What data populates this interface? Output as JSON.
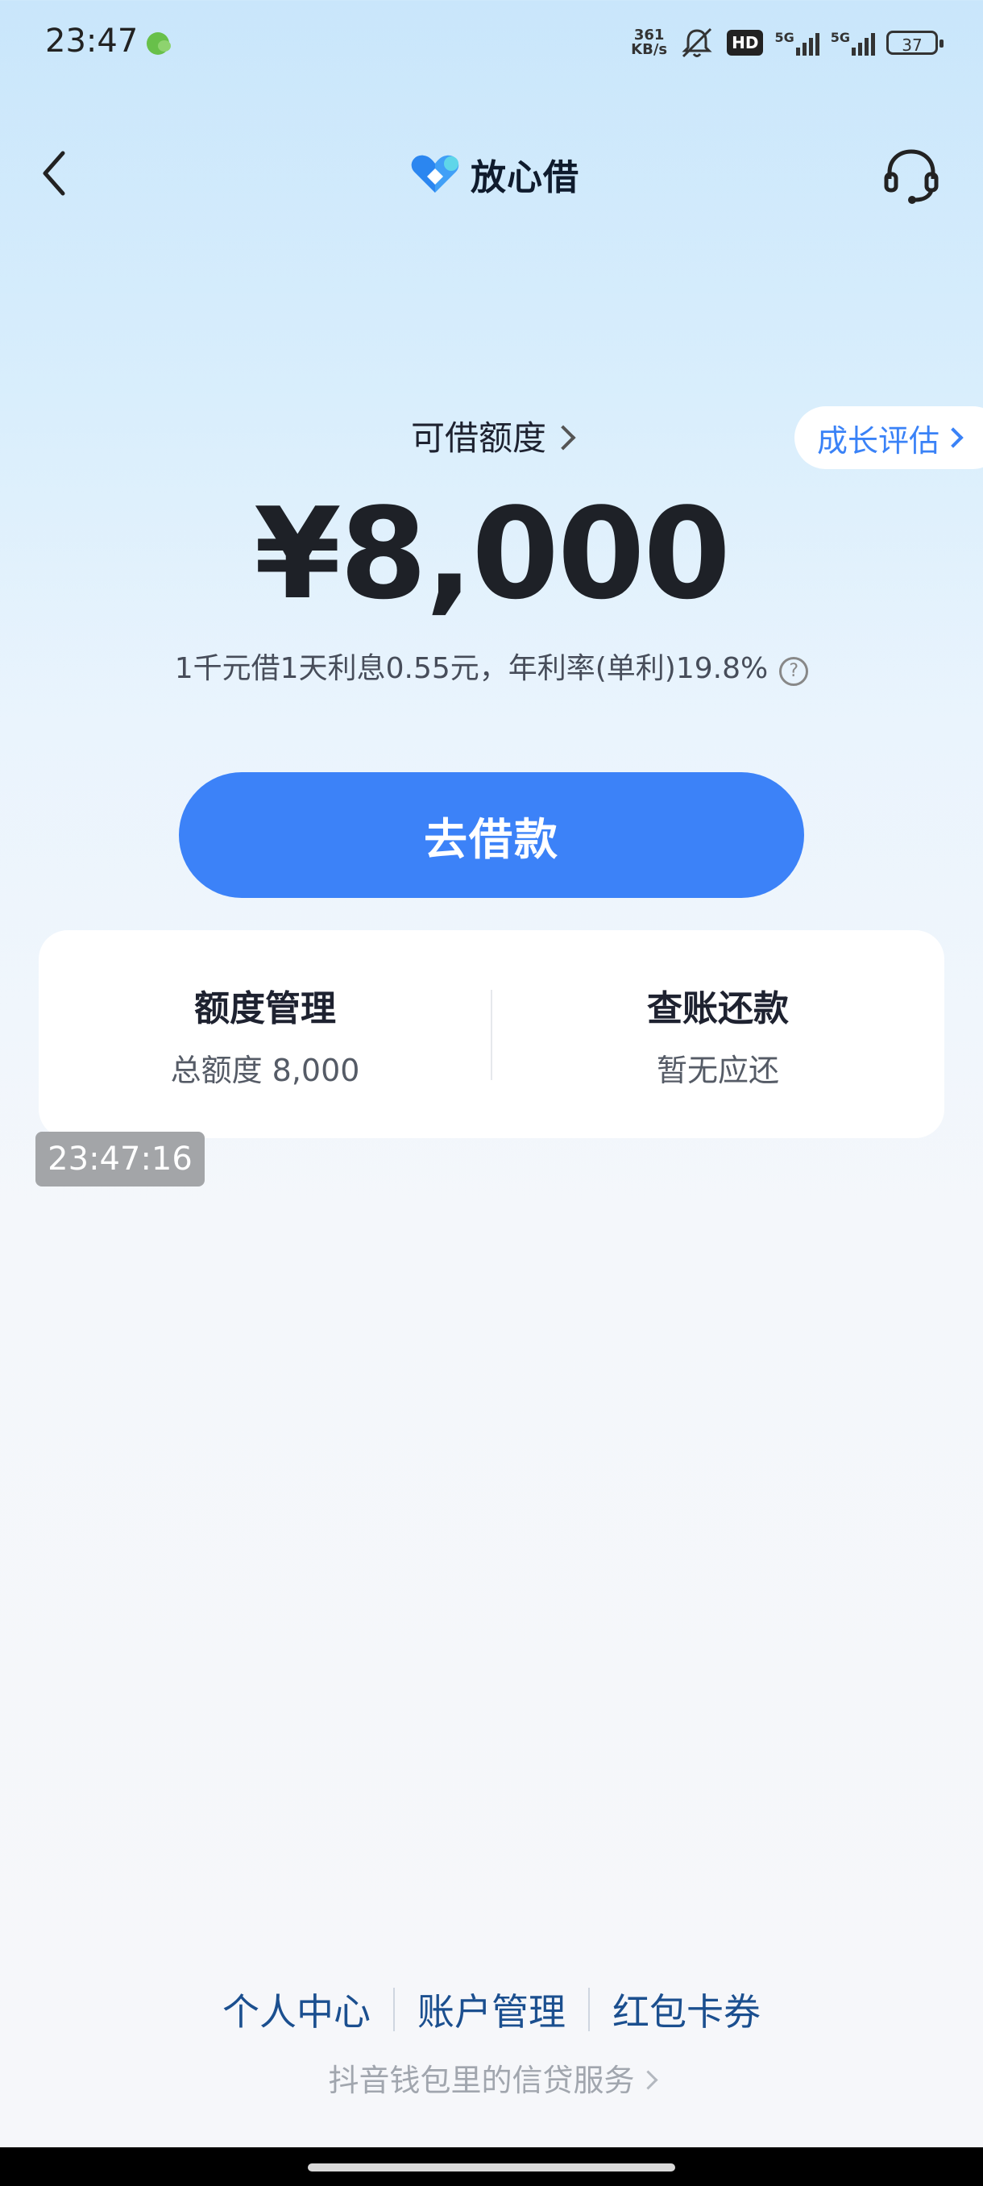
{
  "status_bar": {
    "time": "23:47",
    "net_speed_value": "361",
    "net_speed_unit": "KB/s",
    "hd": "HD",
    "sig1_label": "5G",
    "sig2_label": "5G",
    "battery": "37",
    "icons": [
      "wechat-icon",
      "mute-bell-icon",
      "signal-icon",
      "battery-icon"
    ]
  },
  "header": {
    "brand_name": "放心借",
    "icons": [
      "back-arrow-icon",
      "headset-icon"
    ]
  },
  "limit": {
    "label": "可借额度",
    "growth_label": "成长评估",
    "amount": "¥8,000",
    "rate_text": "1千元借1天利息0.55元，年利率(单利)19.8%",
    "help_glyph": "?"
  },
  "borrow_button": "去借款",
  "card": {
    "left_title": "额度管理",
    "left_sub": "总额度 8,000",
    "right_title": "查账还款",
    "right_sub": "暂无应还"
  },
  "timestamp": "23:47:16",
  "footer": {
    "links": [
      "个人中心",
      "账户管理",
      "红包卡券"
    ],
    "sub": "抖音钱包里的信贷服务"
  },
  "colors": {
    "accent": "#3c82f8",
    "link": "#1b4f8f",
    "growth": "#3a82f7"
  }
}
